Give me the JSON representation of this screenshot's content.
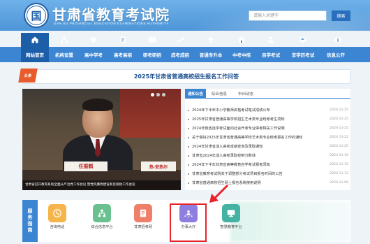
{
  "header": {
    "logo_glyph": "国",
    "title": "甘肃省教育考试院",
    "subtitle": "GAN SU PROVINCIAL EDUCATION EXAMINATIONS AUTHORITY",
    "search_placeholder": "请输入关键字",
    "search_button": "搜索"
  },
  "nav": {
    "items": [
      {
        "label": "网站首页",
        "active": true
      },
      {
        "label": "机构设置"
      },
      {
        "label": "高中学考"
      },
      {
        "label": "高考高招"
      },
      {
        "label": "研考研招"
      },
      {
        "label": "成考成招"
      },
      {
        "label": "普通专升本"
      },
      {
        "label": "中考中招"
      },
      {
        "label": "自学考试"
      },
      {
        "label": "非学历考试"
      },
      {
        "label": "信息公开"
      }
    ]
  },
  "headline": {
    "tag": "头条",
    "text": "2025年甘肃省普通高校招生报名工作问答"
  },
  "photo": {
    "caption": "甘肃省召开教育系统全面从严治党工作会议 暨党风廉政建设和反腐败工作会议",
    "nameplate_left": "任振鹤",
    "nameplate_right": "热·安热尔"
  },
  "news": {
    "tabs": [
      "通知公告",
      "综合信息",
      "市州动态"
    ],
    "items": [
      {
        "title": "2024年下半年中小学教师资格考试笔试成绩公布",
        "date": "2024-11-25"
      },
      {
        "title": "2025年甘肃省普通高等学校招生艺术类专业统考考生须知",
        "date": "2024-11-25"
      },
      {
        "title": "2024年我省自学考试面向社会开考专业停考相关工作说明",
        "date": "2024-11-25"
      },
      {
        "title": "关于做好2025年甘肃省普通高等学校艺术类专业统考报名工作的通知",
        "date": "2024-11-22"
      },
      {
        "title": "2024年甘肃省成人高考成绩查询及录取通知",
        "date": "2024-11-20"
      },
      {
        "title": "甘肃省2024年成人高考录取控制分数线",
        "date": "2024-11-19"
      },
      {
        "title": "2024年下半年甘肃省高等教育自学考试报考须知",
        "date": "2024-11-15"
      },
      {
        "title": "甘肃省教育考试院关于调整部分考试项目报名时间的公告",
        "date": "2024-11-12"
      },
      {
        "title": "甘肃省普通高校招生网上报名系统使用说明",
        "date": "2024-11-08"
      }
    ]
  },
  "services": {
    "label": "服务指南",
    "items": [
      {
        "label": "咨询电话",
        "icon": "phone-icon",
        "color": "#f5b54a"
      },
      {
        "label": "综合信息平台",
        "icon": "network-icon",
        "color": "#6bc08f"
      },
      {
        "label": "甘肃招考网",
        "icon": "document-icon",
        "color": "#ef7f6a"
      },
      {
        "label": "办事大厅",
        "icon": "person-hub-icon",
        "color": "#8e7ee0"
      },
      {
        "label": "智慧教育平台",
        "icon": "monitor-icon",
        "color": "#44b3a3"
      }
    ]
  }
}
